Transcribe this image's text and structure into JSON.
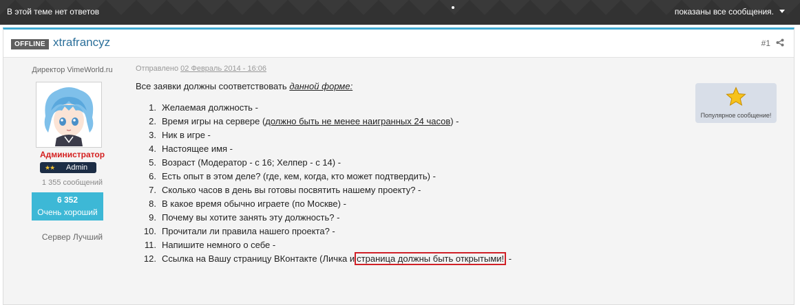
{
  "topbar": {
    "title": "В этой теме нет ответов",
    "filter_label": "показаны все сообщения."
  },
  "post": {
    "status_badge": "OFFLINE",
    "username": "xtrafrancyz",
    "number": "#1",
    "date_prefix": "Отправлено",
    "date": "02 Февраль 2014 - 16:06",
    "intro_text": "Все заявки должны соответствовать",
    "intro_link": "данной форме:",
    "items": [
      {
        "num": "1.",
        "parts": [
          {
            "text": "Желаемая должность -"
          }
        ]
      },
      {
        "num": "2.",
        "parts": [
          {
            "text": "Время игры на сервере ("
          },
          {
            "text": "должно быть не менее наигранных 24 часов",
            "underline": true
          },
          {
            "text": ") -"
          }
        ]
      },
      {
        "num": "3.",
        "parts": [
          {
            "text": "Ник в игре -"
          }
        ]
      },
      {
        "num": "4.",
        "parts": [
          {
            "text": "Настоящее имя -"
          }
        ]
      },
      {
        "num": "5.",
        "parts": [
          {
            "text": "Возраст  (Модератор - с 16; Хелпер - с 14) -"
          }
        ]
      },
      {
        "num": "6.",
        "parts": [
          {
            "text": "Есть опыт в этом деле? (где, кем, когда, кто может подтвердить) -"
          }
        ]
      },
      {
        "num": "7.",
        "parts": [
          {
            "text": "Сколько часов в день вы готовы посвятить нашему проекту? -"
          }
        ]
      },
      {
        "num": "8.",
        "parts": [
          {
            "text": "В какое время обычно играете (по Москве) -"
          }
        ]
      },
      {
        "num": "9.",
        "parts": [
          {
            "text": "Почему вы хотите занять эту должность? -"
          }
        ]
      },
      {
        "num": "10.",
        "parts": [
          {
            "text": "Прочитали ли правила нашего проекта? -"
          }
        ]
      },
      {
        "num": "11.",
        "parts": [
          {
            "text": "Напишите немного о себе -"
          }
        ]
      },
      {
        "num": "12.",
        "parts": [
          {
            "text": "Ссылка на Вашу страницу ВКонтакте (Личка и"
          },
          {
            "text": "страница должны быть открытыми!",
            "boxed": true
          },
          {
            "text": " -"
          }
        ]
      }
    ],
    "popular_label": "Популярное сообщение!"
  },
  "author": {
    "group": "Директор VimeWorld.ru",
    "rank": "Администратор",
    "badge_label": "Admin",
    "badge_stars": "★★",
    "post_count": "1 355 сообщений",
    "reputation_value": "6 352",
    "reputation_label": "Очень хороший",
    "server_label": "Сервер",
    "server_value": "Лучший"
  },
  "colors": {
    "accent": "#3fa9d1",
    "username": "#2b6f9a",
    "rank": "#d41f1f",
    "reputation_bg": "#3db8d6",
    "highlight_box": "#d01f26"
  },
  "icons": [
    "chevron-down-icon",
    "share-icon",
    "star-icon"
  ]
}
